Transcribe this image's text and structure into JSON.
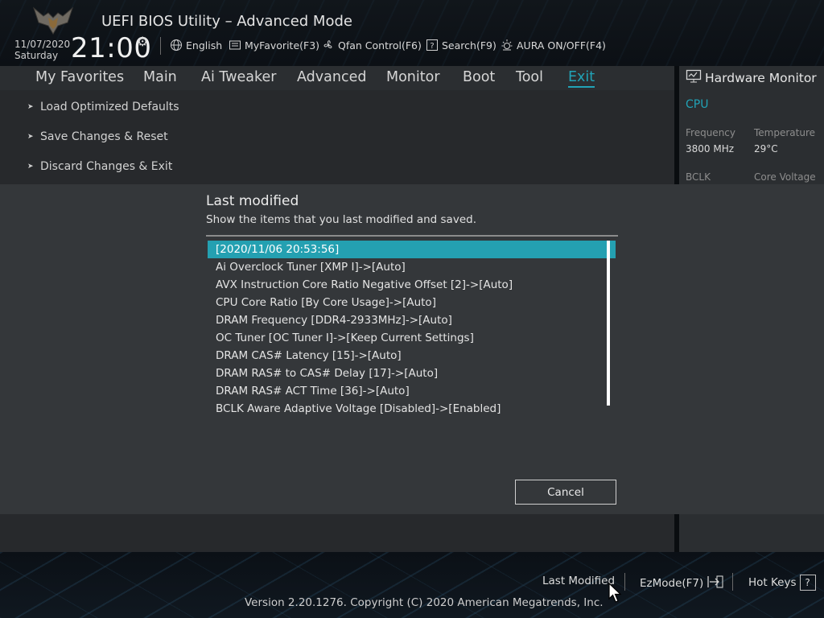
{
  "header": {
    "title": "UEFI BIOS Utility – Advanced Mode",
    "date": "11/07/2020",
    "day": "Saturday",
    "time": "21:00",
    "toolbar": [
      {
        "label": "English",
        "icon": "globe-icon"
      },
      {
        "label": "MyFavorite(F3)",
        "icon": "favorite-icon"
      },
      {
        "label": "Qfan Control(F6)",
        "icon": "fan-icon"
      },
      {
        "label": "Search(F9)",
        "icon": "search-icon"
      },
      {
        "label": "AURA ON/OFF(F4)",
        "icon": "aura-icon"
      }
    ]
  },
  "nav": {
    "tabs": [
      {
        "label": "My Favorites"
      },
      {
        "label": "Main"
      },
      {
        "label": "Ai Tweaker"
      },
      {
        "label": "Advanced"
      },
      {
        "label": "Monitor"
      },
      {
        "label": "Boot"
      },
      {
        "label": "Tool"
      },
      {
        "label": "Exit",
        "active": true
      }
    ]
  },
  "menu": [
    {
      "label": "Load Optimized Defaults"
    },
    {
      "label": "Save Changes & Reset"
    },
    {
      "label": "Discard Changes & Exit"
    }
  ],
  "hardware_monitor": {
    "title": "Hardware Monitor",
    "section": "CPU",
    "frequency_label": "Frequency",
    "frequency_value": "3800 MHz",
    "temperature_label": "Temperature",
    "temperature_value": "29°C",
    "bclk_label": "BCLK",
    "core_voltage_label": "Core Voltage"
  },
  "dialog": {
    "title": "Last modified",
    "subtitle": "Show the items that you last modified and saved.",
    "items": [
      "[2020/11/06 20:53:56]",
      "Ai Overclock Tuner [XMP I]->[Auto]",
      "AVX Instruction Core Ratio Negative Offset [2]->[Auto]",
      "CPU Core Ratio [By Core Usage]->[Auto]",
      "DRAM Frequency [DDR4-2933MHz]->[Auto]",
      "OC Tuner [OC Tuner I]->[Keep Current Settings]",
      "DRAM CAS# Latency [15]->[Auto]",
      "DRAM RAS# to CAS# Delay [17]->[Auto]",
      "DRAM RAS# ACT Time [36]->[Auto]",
      "BCLK Aware Adaptive Voltage [Disabled]->[Enabled]"
    ],
    "cancel_label": "Cancel"
  },
  "footer": {
    "last_modified": "Last Modified",
    "ezmode": "EzMode(F7)",
    "hotkeys": "Hot Keys",
    "version": "Version 2.20.1276. Copyright (C) 2020 American Megatrends, Inc."
  },
  "colors": {
    "accent": "#21a3b7",
    "selection": "#24a0b1"
  }
}
